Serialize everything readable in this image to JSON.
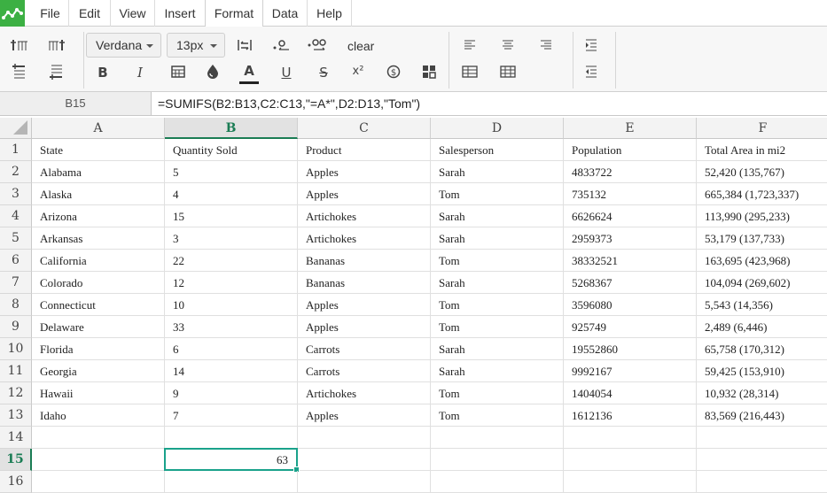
{
  "menu": [
    "File",
    "Edit",
    "View",
    "Insert",
    "Format",
    "Data",
    "Help"
  ],
  "active_menu": "Format",
  "toolbar": {
    "font_family": "Verdana",
    "font_size": "13px",
    "clear_label": "clear",
    "bold_label": "B",
    "italic_label": "I",
    "text_color_label": "A",
    "underline_label": "U",
    "strike_label": "S",
    "superscript_label": "x²"
  },
  "formula_bar": {
    "cell_ref": "B15",
    "formula": "=SUMIFS(B2:B13,C2:C13,\"=A*\",D2:D13,\"Tom\")"
  },
  "columns": [
    "A",
    "B",
    "C",
    "D",
    "E",
    "F"
  ],
  "selected_column": "B",
  "selected_row": "15",
  "rows": [
    {
      "num": "1",
      "cells": [
        "State",
        "Quantity Sold",
        "Product",
        "Salesperson",
        "Population",
        "Total Area in mi2"
      ]
    },
    {
      "num": "2",
      "cells": [
        "Alabama",
        "5",
        "Apples",
        "Sarah",
        "4833722",
        "52,420 (135,767)"
      ]
    },
    {
      "num": "3",
      "cells": [
        "Alaska",
        "4",
        "Apples",
        "Tom",
        "735132",
        "665,384 (1,723,337)"
      ]
    },
    {
      "num": "4",
      "cells": [
        "Arizona",
        "15",
        "Artichokes",
        "Sarah",
        "6626624",
        "113,990 (295,233)"
      ]
    },
    {
      "num": "5",
      "cells": [
        "Arkansas",
        "3",
        "Artichokes",
        "Sarah",
        "2959373",
        "53,179 (137,733)"
      ]
    },
    {
      "num": "6",
      "cells": [
        "California",
        "22",
        "Bananas",
        "Tom",
        "38332521",
        "163,695 (423,968)"
      ]
    },
    {
      "num": "7",
      "cells": [
        "Colorado",
        "12",
        "Bananas",
        "Sarah",
        "5268367",
        "104,094 (269,602)"
      ]
    },
    {
      "num": "8",
      "cells": [
        "Connecticut",
        "10",
        "Apples",
        "Tom",
        "3596080",
        "5,543 (14,356)"
      ]
    },
    {
      "num": "9",
      "cells": [
        "Delaware",
        "33",
        "Apples",
        "Tom",
        "925749",
        "2,489 (6,446)"
      ]
    },
    {
      "num": "10",
      "cells": [
        "Florida",
        "6",
        "Carrots",
        "Sarah",
        "19552860",
        "65,758 (170,312)"
      ]
    },
    {
      "num": "11",
      "cells": [
        "Georgia",
        "14",
        "Carrots",
        "Sarah",
        "9992167",
        "59,425 (153,910)"
      ]
    },
    {
      "num": "12",
      "cells": [
        "Hawaii",
        "9",
        "Artichokes",
        "Tom",
        "1404054",
        "10,932 (28,314)"
      ]
    },
    {
      "num": "13",
      "cells": [
        "Idaho",
        "7",
        "Apples",
        "Tom",
        "1612136",
        "83,569 (216,443)"
      ]
    },
    {
      "num": "14",
      "cells": [
        "",
        "",
        "",
        "",
        "",
        ""
      ]
    },
    {
      "num": "15",
      "cells": [
        "",
        "63",
        "",
        "",
        "",
        ""
      ]
    },
    {
      "num": "16",
      "cells": [
        "",
        "",
        "",
        "",
        "",
        ""
      ]
    }
  ],
  "colors": {
    "brand": "#3cb043",
    "selection": "#1aa28b",
    "header_selected_text": "#1a7c54"
  }
}
